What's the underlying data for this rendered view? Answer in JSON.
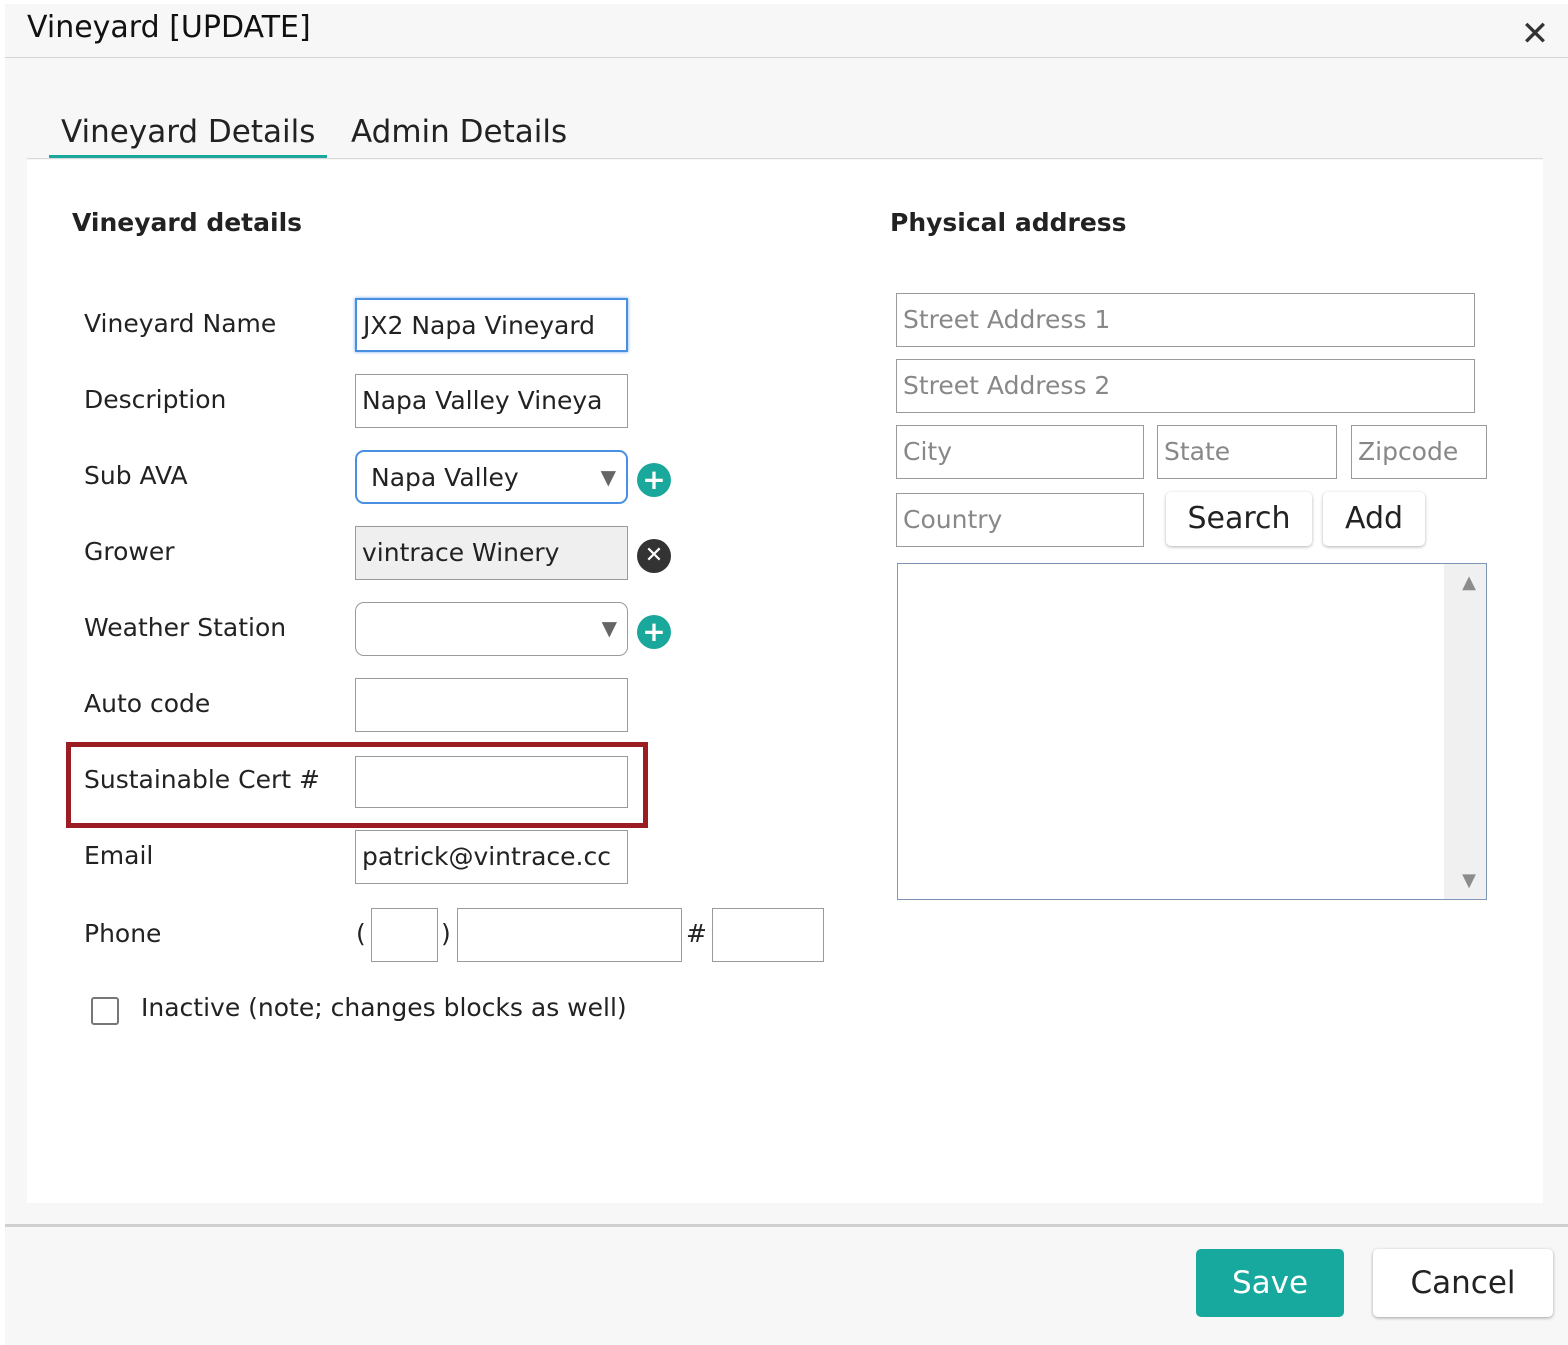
{
  "dialog": {
    "title": "Vineyard [UPDATE]",
    "close_icon": "close-icon"
  },
  "tabs": [
    {
      "label": "Vineyard Details",
      "active": true
    },
    {
      "label": "Admin Details",
      "active": false
    }
  ],
  "details": {
    "section_title": "Vineyard details",
    "fields": {
      "name": {
        "label": "Vineyard Name",
        "value": "JX2 Napa Vineyard"
      },
      "description": {
        "label": "Description",
        "value": "Napa Valley Vineya"
      },
      "sub_ava": {
        "label": "Sub AVA",
        "value": "Napa Valley"
      },
      "grower": {
        "label": "Grower",
        "value": "vintrace Winery"
      },
      "weather_station": {
        "label": "Weather Station",
        "value": ""
      },
      "auto_code": {
        "label": "Auto code",
        "value": ""
      },
      "sustainable_cert": {
        "label": "Sustainable Cert #",
        "value": ""
      },
      "email": {
        "label": "Email",
        "value": "patrick@vintrace.cc"
      },
      "phone": {
        "label": "Phone",
        "open_paren": "(",
        "close_paren": ")",
        "hash": "#",
        "area": "",
        "number": "",
        "ext": ""
      }
    },
    "inactive_label": "Inactive (note; changes blocks as well)",
    "inactive_checked": false
  },
  "address": {
    "section_title": "Physical address",
    "street1_placeholder": "Street Address 1",
    "street2_placeholder": "Street Address 2",
    "city_placeholder": "City",
    "state_placeholder": "State",
    "zipcode_placeholder": "Zipcode",
    "country_placeholder": "Country",
    "search_label": "Search",
    "add_label": "Add"
  },
  "footer": {
    "save_label": "Save",
    "cancel_label": "Cancel"
  },
  "colors": {
    "accent": "#17a89e",
    "highlight": "#9b1c23",
    "focus": "#4a90e2"
  }
}
